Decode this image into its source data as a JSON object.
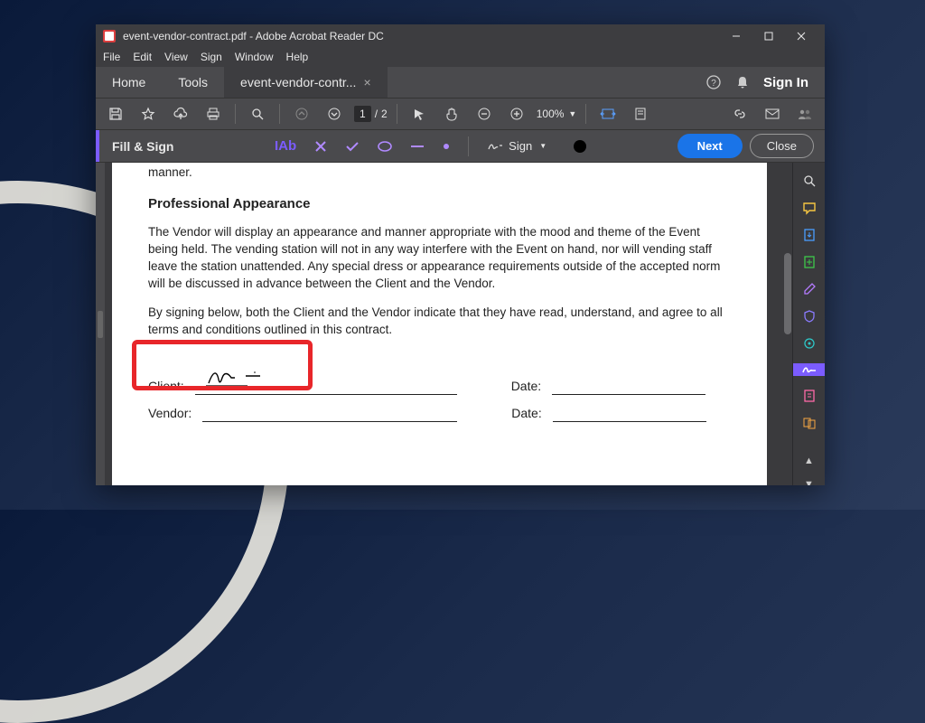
{
  "window": {
    "title": "event-vendor-contract.pdf - Adobe Acrobat Reader DC"
  },
  "menubar": [
    "File",
    "Edit",
    "View",
    "Sign",
    "Window",
    "Help"
  ],
  "tabs": {
    "home": "Home",
    "tools": "Tools",
    "doc": "event-vendor-contr..."
  },
  "signin": "Sign In",
  "toolbar": {
    "page_current": "1",
    "page_total": "2",
    "page_sep": "/",
    "zoom": "100%"
  },
  "fillsign": {
    "title": "Fill & Sign",
    "text_tool": "IAb",
    "sign_label": "Sign",
    "next": "Next",
    "close": "Close"
  },
  "document": {
    "prev_tail": "manner.",
    "heading": "Professional Appearance",
    "para1": "The Vendor will display an appearance and manner appropriate with the mood and theme of the Event being held. The vending station will not in any way interfere with the Event on hand, nor will vending staff leave the station unattended. Any special dress or appearance requirements outside of the accepted norm will be discussed in advance between the Client and the Vendor.",
    "para2": "By signing below, both the Client and the Vendor indicate that they have read, understand, and agree to all terms and conditions outlined in this contract.",
    "label_client": "Client:",
    "label_vendor": "Vendor:",
    "label_date1": "Date:",
    "label_date2": "Date:"
  }
}
